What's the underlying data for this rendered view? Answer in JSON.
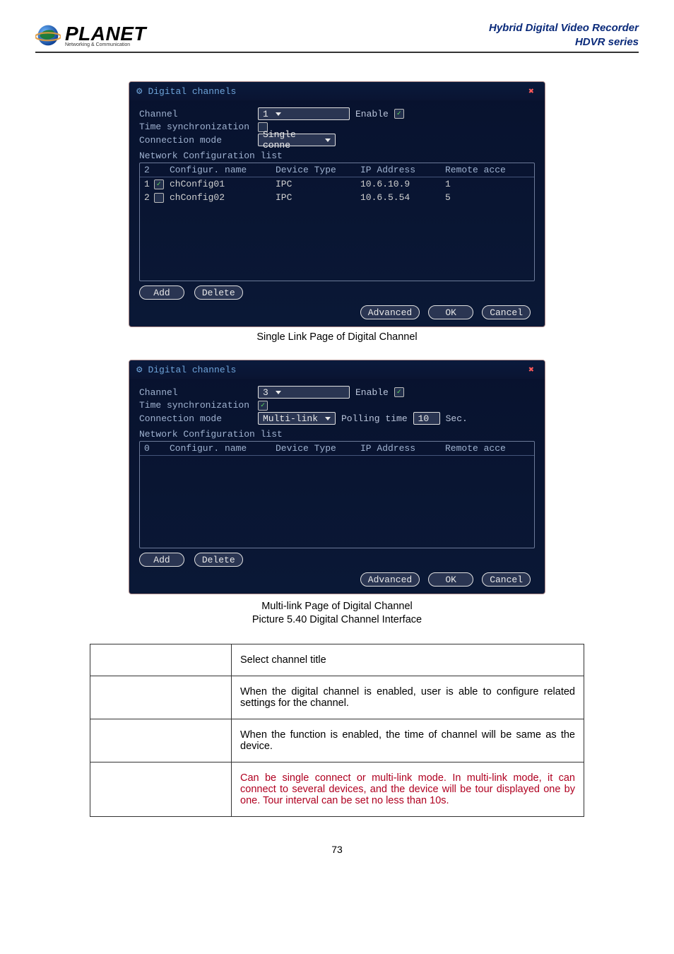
{
  "header": {
    "brand": "PLANET",
    "brand_sub": "Networking & Communication",
    "right_line1": "Hybrid Digital Video Recorder",
    "right_line2": "HDVR series"
  },
  "dialog1": {
    "title": "Digital channels",
    "channel_label": "Channel",
    "channel_value": "1",
    "enable_label": "Enable",
    "enable_checked": true,
    "time_sync_label": "Time synchronization",
    "time_sync_checked": false,
    "conn_mode_label": "Connection mode",
    "conn_mode_value": "Single conne",
    "ncl_label": "Network Configuration list",
    "headers": {
      "c1": "2",
      "c2": "Configur. name",
      "c3": "Device Type",
      "c4": "IP Address",
      "c5": "Remote acce"
    },
    "rows": [
      {
        "n": "1",
        "chk": true,
        "name": "chConfig01",
        "type": "IPC",
        "ip": "10.6.10.9",
        "ra": "1"
      },
      {
        "n": "2",
        "chk": false,
        "name": "chConfig02",
        "type": "IPC",
        "ip": "10.6.5.54",
        "ra": "5"
      }
    ],
    "add": "Add",
    "delete": "Delete",
    "advanced": "Advanced",
    "ok": "OK",
    "cancel": "Cancel"
  },
  "caption1": "Single Link Page of Digital Channel",
  "dialog2": {
    "title": "Digital channels",
    "channel_label": "Channel",
    "channel_value": "3",
    "enable_label": "Enable",
    "enable_checked": true,
    "time_sync_label": "Time synchronization",
    "time_sync_checked": true,
    "conn_mode_label": "Connection mode",
    "conn_mode_value": "Multi-link",
    "polling_label": "Polling time",
    "polling_value": "10",
    "polling_unit": "Sec.",
    "ncl_label": "Network Configuration list",
    "headers": {
      "c1": "0",
      "c2": "Configur. name",
      "c3": "Device Type",
      "c4": "IP Address",
      "c5": "Remote acce"
    },
    "add": "Add",
    "delete": "Delete",
    "advanced": "Advanced",
    "ok": "OK",
    "cancel": "Cancel"
  },
  "caption2_line1": "Multi-link Page of Digital Channel",
  "caption2_line2": "Picture 5.40 Digital Channel Interface",
  "info_table": {
    "rows": [
      {
        "key": "",
        "val": "Select channel title"
      },
      {
        "key": "",
        "val": "When the digital channel is enabled, user is able to configure related settings for the channel."
      },
      {
        "key": "",
        "val": "When the function is enabled, the time of channel will be same as the device."
      },
      {
        "key": "",
        "val": "Can be single connect or multi-link mode. In multi-link mode, it can connect to several devices, and the device will be tour displayed one by one. Tour interval can be set no less than 10s."
      }
    ]
  },
  "page_number": "73"
}
